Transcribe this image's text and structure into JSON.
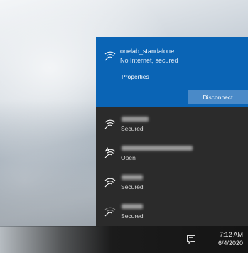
{
  "connected_network": {
    "name": "onelab_standalone",
    "status": "No Internet, secured",
    "properties_label": "Properties",
    "disconnect_label": "Disconnect",
    "icon": "wifi-icon"
  },
  "networks": [
    {
      "status": "Secured",
      "icon": "wifi-icon"
    },
    {
      "status": "Open",
      "icon": "wifi-open-icon"
    },
    {
      "status": "Secured",
      "icon": "wifi-icon"
    },
    {
      "status": "Secured",
      "icon": "wifi-icon"
    }
  ],
  "taskbar": {
    "time": "7:12 AM",
    "date": "6/4/2020",
    "action_center_icon": "action-center-icon"
  },
  "colors": {
    "accent": "#0a64b5",
    "flyout_bg": "#2b2b2b",
    "button_bg": "#4a8ac8"
  }
}
